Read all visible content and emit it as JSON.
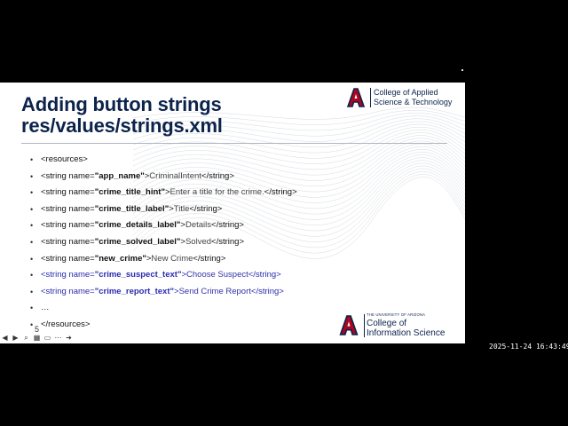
{
  "slide": {
    "title_lines": [
      "Adding button strings",
      "res/values/strings.xml"
    ],
    "logo_top": {
      "lines": [
        "College of Applied",
        "Science & Technology"
      ]
    },
    "logo_bottom": {
      "university": "THE UNIVERSITY OF ARIZONA",
      "lines": [
        "College of",
        "Information Science"
      ]
    },
    "page_number": "5",
    "bullet_glyph": "•",
    "code_lines": [
      {
        "tag": "<resources>",
        "attr": "",
        "mid": "",
        "val": "",
        "close": "",
        "highlight": false
      },
      {
        "tag": "<string name=",
        "attr": "\"app_name\"",
        "mid": ">",
        "val": "CriminalIntent",
        "close": "</string>",
        "highlight": false
      },
      {
        "tag": "<string name=",
        "attr": "\"crime_title_hint\"",
        "mid": ">",
        "val": "Enter a title for the crime.",
        "close": "</string>",
        "highlight": false
      },
      {
        "tag": "<string name=",
        "attr": "\"crime_title_label\"",
        "mid": ">",
        "val": "Title",
        "close": "</string>",
        "highlight": false
      },
      {
        "tag": "<string name=",
        "attr": "\"crime_details_label\"",
        "mid": ">",
        "val": "Details",
        "close": "</string>",
        "highlight": false
      },
      {
        "tag": "<string name=",
        "attr": "\"crime_solved_label\"",
        "mid": ">",
        "val": "Solved",
        "close": "</string>",
        "highlight": false
      },
      {
        "tag": "<string name=",
        "attr": "\"new_crime\"",
        "mid": ">",
        "val": "New Crime",
        "close": "</string>",
        "highlight": false
      },
      {
        "tag": "<string name=",
        "attr": "\"crime_suspect_text\"",
        "mid": ">",
        "val": "Choose Suspect",
        "close": "</string>",
        "highlight": true
      },
      {
        "tag": "<string name=",
        "attr": "\"crime_report_text\"",
        "mid": ">",
        "val": "Send Crime Report",
        "close": "</string>",
        "highlight": true
      },
      {
        "tag": "…",
        "attr": "",
        "mid": "",
        "val": "",
        "close": "",
        "highlight": false
      },
      {
        "tag": "</resources>",
        "attr": "",
        "mid": "",
        "val": "",
        "close": "",
        "highlight": false
      }
    ]
  },
  "player_controls": [
    {
      "name": "back-arrow-icon",
      "glyph": "◀"
    },
    {
      "name": "forward-arrow-icon",
      "glyph": "▶"
    },
    {
      "name": "zoom-icon",
      "glyph": "⌕"
    },
    {
      "name": "grid-view-icon",
      "glyph": "▦"
    },
    {
      "name": "captions-icon",
      "glyph": "▭"
    },
    {
      "name": "more-options-icon",
      "glyph": "⋯"
    },
    {
      "name": "next-slide-icon",
      "glyph": "➜"
    }
  ],
  "timestamp": "2025-11-24 16:43:49",
  "colors": {
    "background": "#000000",
    "slide": "#ffffff",
    "title": "#0c234b",
    "arizona_red": "#ab0520",
    "arizona_blue": "#0c234b",
    "highlight": "#2b2bb0"
  }
}
